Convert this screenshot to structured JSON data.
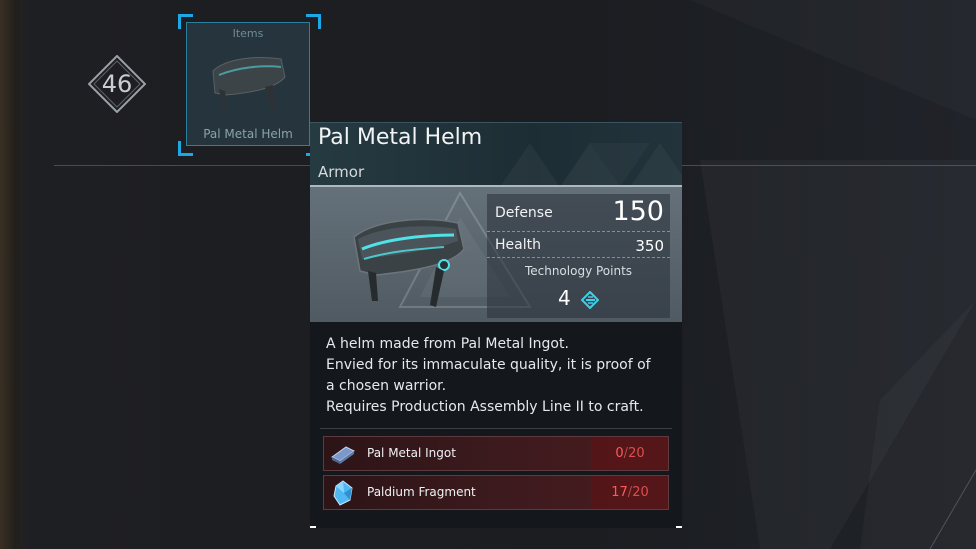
{
  "player": {
    "level": "46"
  },
  "slot": {
    "category": "Items",
    "name": "Pal Metal Helm"
  },
  "tooltip": {
    "title": "Pal Metal Helm",
    "type": "Armor",
    "stats": {
      "defense_label": "Defense",
      "defense_value": "150",
      "health_label": "Health",
      "health_value": "350",
      "tech_label": "Technology Points",
      "tech_value": "4"
    },
    "description": [
      "A helm made from Pal Metal Ingot.",
      "Envied for its immaculate quality, it is proof of",
      "a chosen warrior.",
      "Requires Production Assembly Line II to craft."
    ],
    "materials": [
      {
        "name": "Pal Metal Ingot",
        "have": "0",
        "need": "20",
        "icon": "ingot-icon"
      },
      {
        "name": "Paldium Fragment",
        "have": "17",
        "need": "20",
        "icon": "paldium-icon"
      }
    ]
  },
  "colors": {
    "accent": "#1aa8e6",
    "shortage": "#ff5a5a",
    "tech": "#3fd0e8"
  }
}
